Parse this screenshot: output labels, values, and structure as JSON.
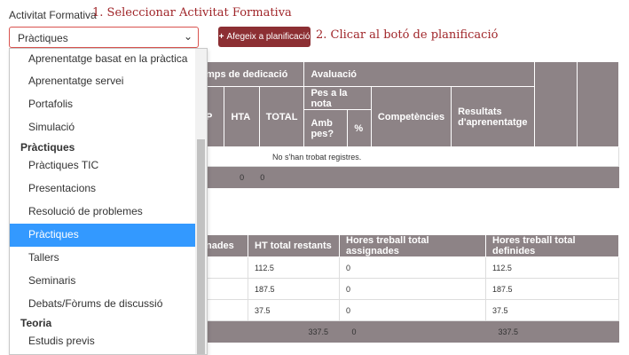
{
  "form": {
    "label": "Activitat Formativa",
    "select_value": "Pràctiques",
    "chevron": "⌄",
    "add_button": "Afegeix a planificació",
    "add_icon": "+"
  },
  "annotations": {
    "step1": "1. Seleccionar Activitat Formativa",
    "step2": "2. Clicar al botó de planificació"
  },
  "dropdown": {
    "items": [
      {
        "type": "option",
        "label": "Aprenentatge basat en la pràctica"
      },
      {
        "type": "option",
        "label": "Aprenentatge servei"
      },
      {
        "type": "option",
        "label": "Portafolis"
      },
      {
        "type": "option",
        "label": "Simulació"
      },
      {
        "type": "group",
        "label": "Pràctiques"
      },
      {
        "type": "option",
        "label": "Pràctiques TIC"
      },
      {
        "type": "option",
        "label": "Presentacions"
      },
      {
        "type": "option",
        "label": "Resolució de problemes"
      },
      {
        "type": "option",
        "label": "Pràctiques",
        "selected": true
      },
      {
        "type": "option",
        "label": "Tallers"
      },
      {
        "type": "option",
        "label": "Seminaris"
      },
      {
        "type": "option",
        "label": "Debats/Fòrums de discussió"
      },
      {
        "type": "group",
        "label": "Teoria"
      },
      {
        "type": "option",
        "label": "Estudis previs"
      }
    ]
  },
  "table1": {
    "h_temps": "mps de dedicació",
    "h_avaluacio": "Avaluació",
    "h_p": "P",
    "h_hta": "HTA",
    "h_total": "TOTAL",
    "h_pes": "Pes a la nota",
    "h_competencies": "Competències",
    "h_resultats": "Resultats d'aprenentatge",
    "h_amb_pes": "Amb pes?",
    "h_pct": "%",
    "empty": "No s'han trobat registres.",
    "foot_hta": "0",
    "foot_total": "0"
  },
  "table2": {
    "headers": [
      "nades",
      "HT total restants",
      "Hores treball total assignades",
      "Hores treball total definides"
    ],
    "rows": [
      [
        "",
        "112.5",
        "0",
        "112.5"
      ],
      [
        "",
        "187.5",
        "0",
        "187.5"
      ],
      [
        "",
        "37.5",
        "0",
        "37.5"
      ]
    ],
    "footer": [
      "",
      "337.5",
      "0",
      "337.5"
    ]
  }
}
